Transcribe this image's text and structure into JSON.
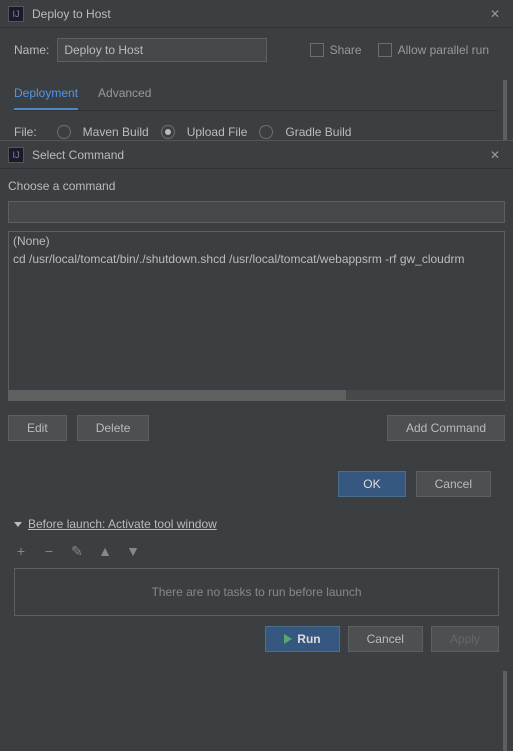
{
  "parent": {
    "title": "Deploy to Host",
    "name_label": "Name:",
    "name_value": "Deploy to Host",
    "share_label": "Share",
    "parallel_label": "Allow parallel run",
    "tabs": {
      "deployment": "Deployment",
      "advanced": "Advanced"
    },
    "file_label": "File:",
    "radios": {
      "maven": "Maven Build",
      "upload": "Upload File",
      "gradle": "Gradle Build"
    }
  },
  "dialog": {
    "title": "Select Command",
    "choose_label": "Choose a command",
    "items": {
      "none": "(None)",
      "cmd": "cd /usr/local/tomcat/bin/./shutdown.shcd /usr/local/tomcat/webappsrm -rf gw_cloudrm"
    },
    "buttons": {
      "edit": "Edit",
      "delete": "Delete",
      "add": "Add Command",
      "ok": "OK",
      "cancel": "Cancel"
    }
  },
  "before_launch": {
    "header": "Before launch: Activate tool window",
    "empty": "There are no tasks to run before launch"
  },
  "footer": {
    "run": "Run",
    "cancel": "Cancel",
    "apply": "Apply"
  }
}
